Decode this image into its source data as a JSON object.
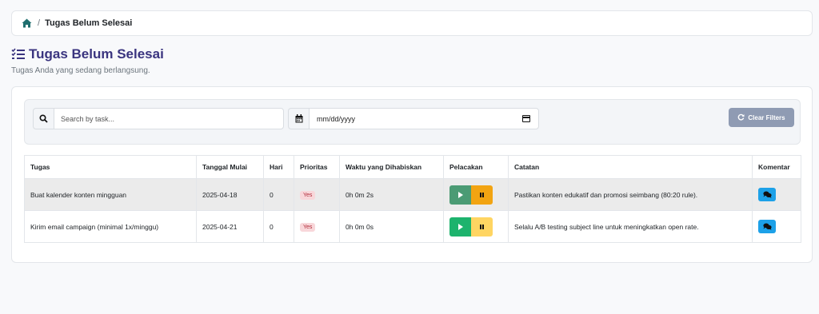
{
  "breadcrumb": {
    "home_icon": "home-icon",
    "separator": "/",
    "current": "Tugas Belum Selesai"
  },
  "header": {
    "icon": "task-list-icon",
    "title": "Tugas Belum Selesai",
    "subtitle": "Tugas Anda yang sedang berlangsung."
  },
  "filters": {
    "search_icon": "search-icon",
    "search_placeholder": "Search by task...",
    "date_icon": "calendar-icon",
    "date_placeholder": "mm/dd/yyyy",
    "clear_label": "Clear Filters",
    "clear_icon": "refresh-icon"
  },
  "table": {
    "headers": [
      "Tugas",
      "Tanggal Mulai",
      "Hari",
      "Prioritas",
      "Waktu yang Dihabiskan",
      "Pelacakan",
      "Catatan",
      "Komentar"
    ],
    "rows": [
      {
        "task": "Buat kalender konten mingguan",
        "start_date": "2025-04-18",
        "days": "0",
        "priority": "Yes",
        "time_spent": "0h 0m 2s",
        "tracking_state": "running",
        "note": "Pastikan konten edukatif dan promosi seimbang (80:20 rule)."
      },
      {
        "task": "Kirim email campaign (minimal 1x/minggu)",
        "start_date": "2025-04-21",
        "days": "0",
        "priority": "Yes",
        "time_spent": "0h 0m 0s",
        "tracking_state": "idle",
        "note": "Selalu A/B testing subject line untuk meningkatkan open rate."
      }
    ]
  },
  "colors": {
    "title": "#3a347f",
    "play_active": "#1db36d",
    "pause_active": "#f2a412",
    "comment": "#1da1e8",
    "badge_bg": "#f8d7da"
  }
}
